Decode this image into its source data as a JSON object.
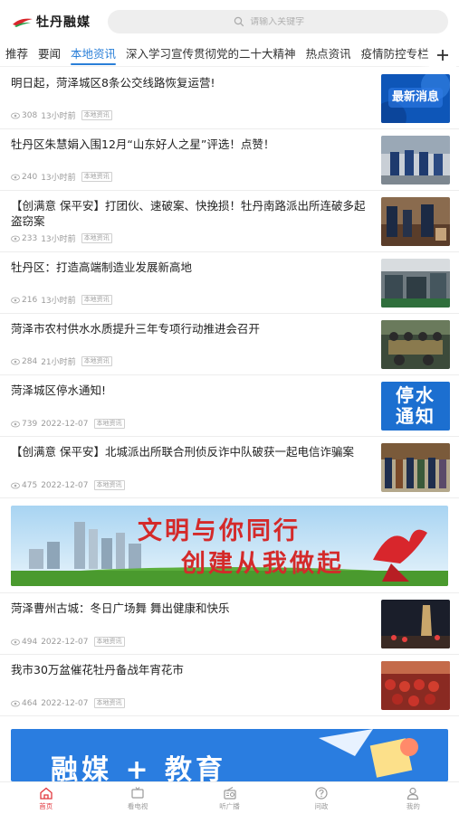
{
  "header": {
    "logo_text": "牡丹融媒",
    "search_placeholder": "请输入关键字"
  },
  "tabs": [
    {
      "label": "推荐",
      "active": false
    },
    {
      "label": "要闻",
      "active": false
    },
    {
      "label": "本地资讯",
      "active": true
    },
    {
      "label": "深入学习宣传贯彻党的二十大精神",
      "active": false
    },
    {
      "label": "热点资讯",
      "active": false
    },
    {
      "label": "疫情防控专栏",
      "active": false
    }
  ],
  "news": [
    {
      "title": "明日起，菏泽城区8条公交线路恢复运营!",
      "views": "308",
      "time": "13小时前",
      "badge": "本地资讯",
      "thumb_text": "最新消息"
    },
    {
      "title": "牡丹区朱慧娟入围12月“山东好人之星”评选！点赞！",
      "views": "240",
      "time": "13小时前",
      "badge": "本地资讯"
    },
    {
      "title": "【创满意  保平安】打团伙、速破案、快挽损！牡丹南路派出所连破多起盗窃案",
      "views": "233",
      "time": "13小时前",
      "badge": "本地资讯"
    },
    {
      "title": "牡丹区：打造高端制造业发展新高地",
      "views": "216",
      "time": "13小时前",
      "badge": "本地资讯"
    },
    {
      "title": "菏泽市农村供水水质提升三年专项行动推进会召开",
      "views": "284",
      "time": "21小时前",
      "badge": "本地资讯"
    },
    {
      "title": "菏泽城区停水通知!",
      "views": "739",
      "time": "2022-12-07",
      "badge": "本地资讯",
      "thumb_text": "停水通知"
    },
    {
      "title": "【创满意  保平安】北城派出所联合刑侦反诈中队破获一起电信诈骗案",
      "views": "475",
      "time": "2022-12-07",
      "badge": "本地资讯"
    }
  ],
  "banner": {
    "line1": "文明与你同行",
    "line2": "创建从我做起"
  },
  "news2": [
    {
      "title": "菏泽曹州古城：冬日广场舞  舞出健康和快乐",
      "views": "494",
      "time": "2022-12-07",
      "badge": "本地资讯"
    },
    {
      "title": "我市30万盆催花牡丹备战年宵花市",
      "views": "464",
      "time": "2022-12-07",
      "badge": "本地资讯"
    }
  ],
  "bottom_banner": {
    "text": "融媒 + 教育"
  },
  "bottom_nav": [
    {
      "label": "首页",
      "icon": "home-icon",
      "active": true
    },
    {
      "label": "看电视",
      "icon": "tv-icon",
      "active": false
    },
    {
      "label": "听广播",
      "icon": "radio-icon",
      "active": false
    },
    {
      "label": "问政",
      "icon": "question-icon",
      "active": false
    },
    {
      "label": "我的",
      "icon": "user-icon",
      "active": false
    }
  ],
  "colors": {
    "accent": "#2a7fd8",
    "nav_active": "#e2383f"
  }
}
